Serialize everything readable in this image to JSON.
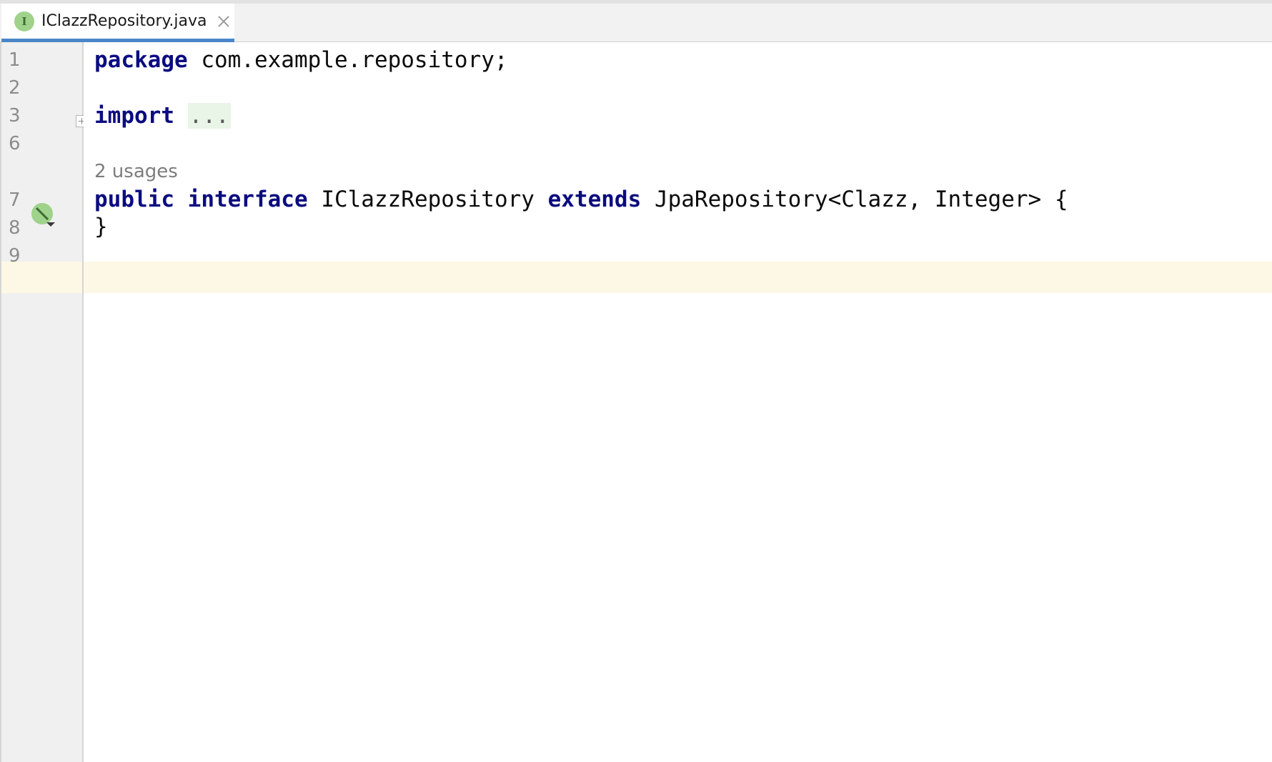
{
  "tab": {
    "icon_letter": "I",
    "title": "IClazzRepository.java"
  },
  "gutter": {
    "line_numbers": [
      "1",
      "2",
      "3",
      "6",
      "7",
      "8",
      "9"
    ]
  },
  "code": {
    "line1": {
      "kw": "package",
      "rest": " com.example.repository;"
    },
    "line3": {
      "kw": "import",
      "folded": "..."
    },
    "usages_hint": "2 usages",
    "line7": {
      "kw1": "public",
      "kw2": "interface",
      "name": "IClazzRepository",
      "kw3": "extends",
      "rest": "JpaRepository<Clazz, Integer> {"
    },
    "line8": "}"
  },
  "colors": {
    "keyword": "#0b0b80",
    "current_line": "#fdf8e5",
    "tab_underline": "#4a86c8",
    "interface_icon": "#9fd28b"
  }
}
